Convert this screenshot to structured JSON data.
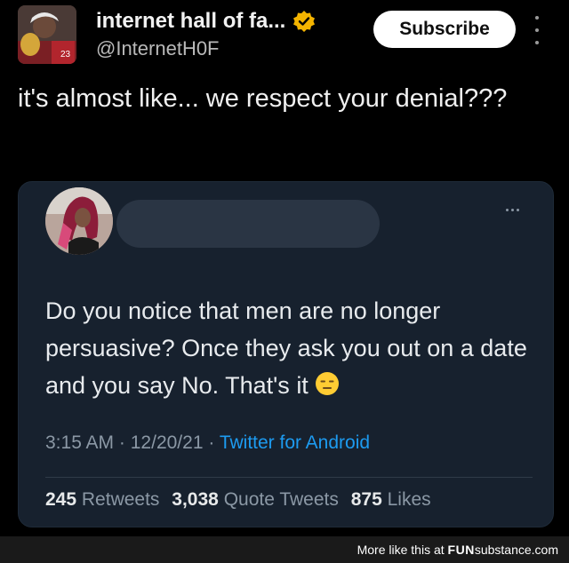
{
  "header": {
    "display_name": "internet hall of fa...",
    "handle": "@InternetH0F",
    "subscribe_label": "Subscribe"
  },
  "caption": "it's almost like... we respect your denial???",
  "quoted_tweet": {
    "text": "Do you notice that men are no longer persuasive? Once they ask you out on a date and you say No. That's it",
    "emoji": "expressionless-face",
    "time": "3:15 AM",
    "date": "12/20/21",
    "source": "Twitter for Android",
    "stats": {
      "retweets_count": "245",
      "retweets_label": "Retweets",
      "quotes_count": "3,038",
      "quotes_label": "Quote Tweets",
      "likes_count": "875",
      "likes_label": "Likes"
    }
  },
  "footer": {
    "prefix": "More like this at",
    "brand_bold": "FUN",
    "brand_rest": "substance.com"
  },
  "colors": {
    "background": "#000000",
    "card": "#17212e",
    "link": "#1d9bf0",
    "verified": "#f4b400"
  }
}
